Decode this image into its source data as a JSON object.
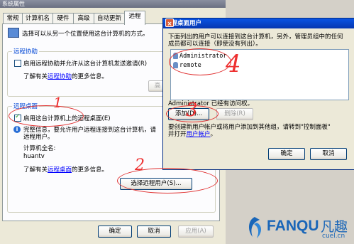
{
  "system_properties": {
    "title": "系统属性",
    "tabs": [
      {
        "label": "常规"
      },
      {
        "label": "计算机名"
      },
      {
        "label": "硬件"
      },
      {
        "label": "高级"
      },
      {
        "label": "自动更新"
      },
      {
        "label": "远程"
      }
    ],
    "active_tab": "远程",
    "intro_text": "选择可以从另一个位置使用这台计算机的方式。",
    "remote_assistance": {
      "group_title": "远程协助",
      "checkbox_label": "启用远程协助并允许从这台计算机发送邀请(R)",
      "checked": false,
      "more_info_prefix": "了解有关",
      "more_info_link": "远程协助",
      "more_info_suffix": "的更多信息。",
      "advanced_button": "高"
    },
    "remote_desktop": {
      "group_title": "远程桌面",
      "checkbox_label": "启用这台计算机上的远程桌面(E)",
      "checked": true,
      "warn_line1": "完整信息，要允许用户远程连接到这台计算机，请",
      "warn_line2": "远程用户。",
      "computer_name_label": "计算机全名:",
      "computer_name_value": "huantv",
      "more_info_prefix": "了解有关",
      "more_info_link": "远程桌面",
      "more_info_suffix": "的更多信息。",
      "select_users_button": "选择远程用户(S)..."
    },
    "footer_buttons": {
      "ok": "确定",
      "cancel": "取消",
      "apply": "应用(A)"
    }
  },
  "remote_desktop_users": {
    "title": "远程桌面用户",
    "help_glyph": "?",
    "close_glyph": "×",
    "description_line1": "下面列出的用户可以连接到这台计算机，另外，管理员组中的任何",
    "description_line2": "成员都可以连接（即使没有列出）。",
    "users": [
      "Administrator",
      "remote"
    ],
    "access_note": "Administrator 已经有访问权。",
    "add_button": "添加(D)...",
    "remove_button": "删除(R)",
    "help_line1": "要创建新用户帐户或将用户添加到其他组，请转到\"控制面板\"",
    "help_line2_prefix": "并打开",
    "help_link": "用户帐户",
    "help_line2_suffix": "。",
    "ok_button": "确定",
    "cancel_button": "取消"
  },
  "annotations": {
    "step1": "1",
    "step2": "2",
    "step3": "3",
    "step4": "4"
  },
  "watermark": {
    "brand": "FANQU",
    "brand_cn": "凡趣",
    "domain": "cuel.cn"
  },
  "colors": {
    "annotation_red": "#ee3030",
    "link_blue": "#0000ff",
    "title_blue": "#0a54e4",
    "watermark_blue": "#1a66b8"
  }
}
